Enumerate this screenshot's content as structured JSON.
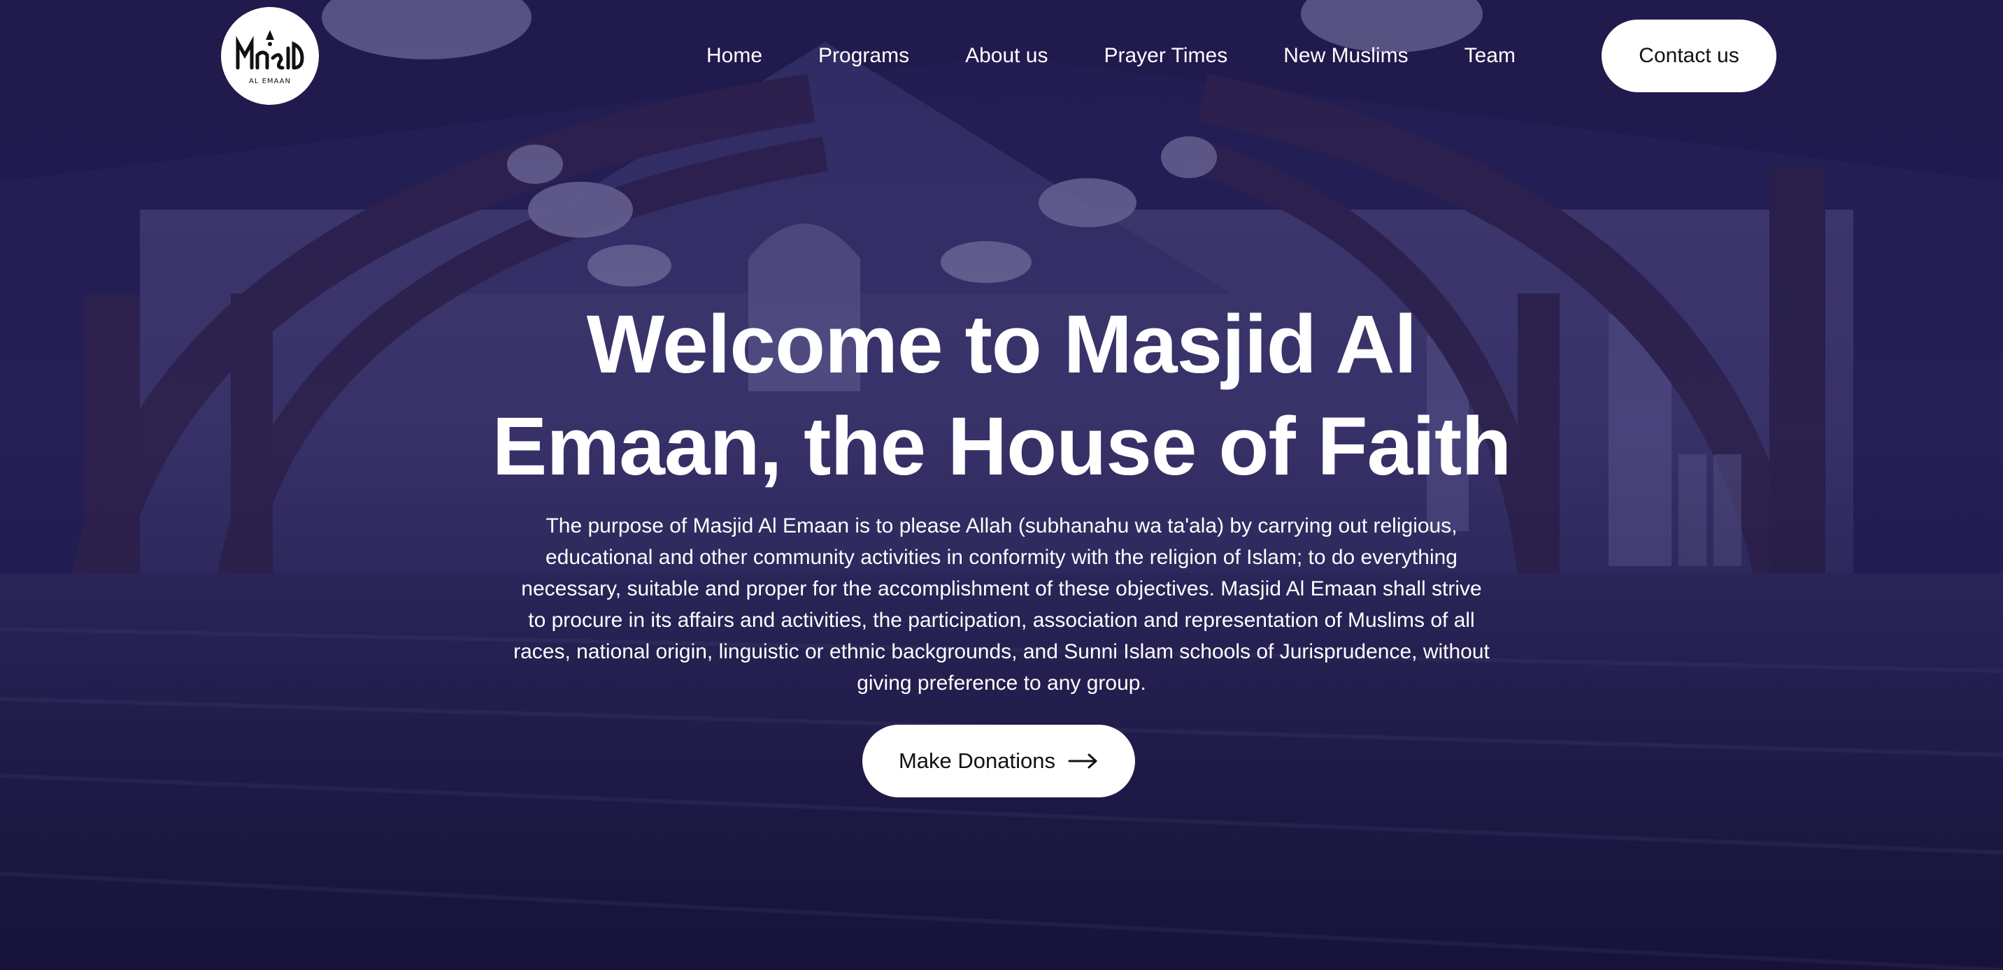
{
  "logo": {
    "text": "AL EMAAN",
    "alt": "Masjid"
  },
  "nav": {
    "items": [
      {
        "label": "Home"
      },
      {
        "label": "Programs"
      },
      {
        "label": "About us"
      },
      {
        "label": "Prayer Times"
      },
      {
        "label": "New Muslims"
      },
      {
        "label": "Team"
      }
    ],
    "contact_label": "Contact us"
  },
  "hero": {
    "title": "Welcome to Masjid Al Emaan, the House of Faith",
    "description": "The purpose of Masjid Al Emaan is to please Allah (subhanahu wa ta'ala) by carrying out religious, educational and other community activities in conformity with the religion of Islam; to do everything necessary, suitable and proper for the accomplishment of these objectives. Masjid Al Emaan shall strive to procure in its affairs and activities, the participation, association and representation of Muslims of all races, national origin, linguistic or ethnic backgrounds, and Sunni Islam schools of Jurisprudence, without giving preference to any group.",
    "donate_label": "Make Donations",
    "donate_icon": "arrow-right-icon"
  },
  "colors": {
    "overlay": "#1f1a47",
    "button_bg": "#ffffff",
    "text": "#ffffff"
  }
}
